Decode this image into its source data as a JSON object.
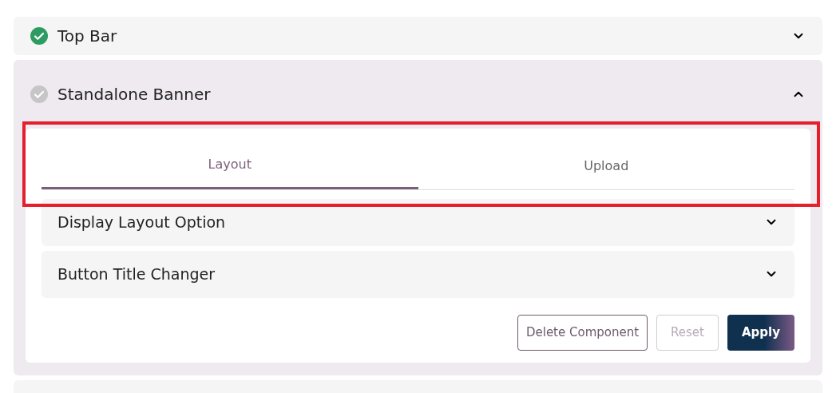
{
  "sections": [
    {
      "title": "Top Bar",
      "complete": true,
      "expanded": false
    },
    {
      "title": "Standalone Banner",
      "complete": false,
      "expanded": true,
      "tabs": [
        {
          "label": "Layout",
          "selected": true
        },
        {
          "label": "Upload",
          "selected": false
        }
      ],
      "tabs_highlighted": true,
      "options": [
        {
          "title": "Display Layout Option",
          "expanded": false
        },
        {
          "title": "Button Title Changer",
          "expanded": false
        }
      ],
      "buttons": [
        {
          "label": "Delete Component",
          "kind": "outline",
          "disabled": false
        },
        {
          "label": "Reset",
          "kind": "outline",
          "disabled": true
        },
        {
          "label": "Apply",
          "kind": "primary",
          "disabled": false
        }
      ]
    },
    {
      "kind": "cut"
    }
  ]
}
